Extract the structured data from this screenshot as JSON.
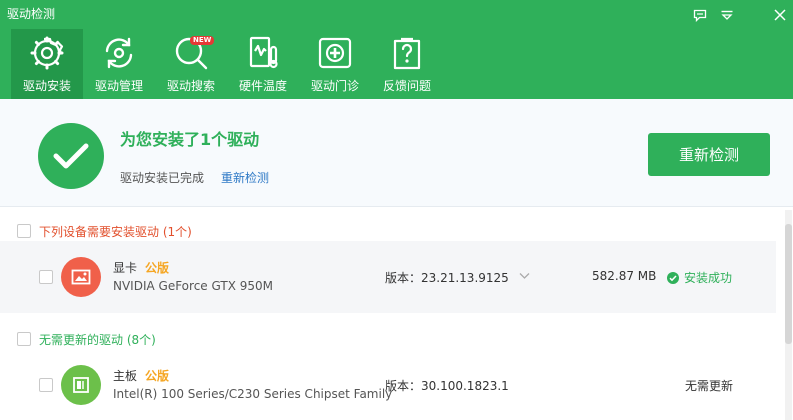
{
  "window": {
    "title": "驱动检测",
    "controls": [
      "feedback-icon",
      "menu-icon",
      "close-icon"
    ]
  },
  "tabs": [
    {
      "label": "驱动安装",
      "icon": "gear-icon",
      "active": true
    },
    {
      "label": "驱动管理",
      "icon": "refresh-icon",
      "active": false
    },
    {
      "label": "驱动搜索",
      "icon": "search-icon",
      "active": false,
      "badge": "NEW"
    },
    {
      "label": "硬件温度",
      "icon": "thermometer-icon",
      "active": false
    },
    {
      "label": "驱动门诊",
      "icon": "first-aid-icon",
      "active": false
    },
    {
      "label": "反馈问题",
      "icon": "question-icon",
      "active": false
    }
  ],
  "summary": {
    "title": "为您安装了1个驱动",
    "subtitle": "驱动安装已完成",
    "rescan_link": "重新检测",
    "rescan_button": "重新检测"
  },
  "sections": [
    {
      "title": "下列设备需要安装驱动 (1个)",
      "title_color": "#e2502d",
      "items": [
        {
          "name": "显卡",
          "tag": "公版",
          "model": "NVIDIA GeForce GTX 950M",
          "version": "版本：23.21.13.9125",
          "size": "582.87 MB",
          "status": "安装成功",
          "icon": "graphics-card-icon",
          "icon_color": "#f0604a"
        }
      ]
    },
    {
      "title": "无需更新的驱动 (8个)",
      "title_color": "#2fb05a",
      "items": [
        {
          "name": "主板",
          "tag": "公版",
          "model": "Intel(R) 100 Series/C230 Series Chipset Family",
          "version": "版本：30.100.1823.1",
          "status": "无需更新",
          "icon": "motherboard-icon",
          "icon_color": "#6cc04a"
        }
      ]
    }
  ],
  "colors": {
    "brand": "#2fb05a",
    "link": "#2f79c6",
    "tag": "#f5a623"
  }
}
